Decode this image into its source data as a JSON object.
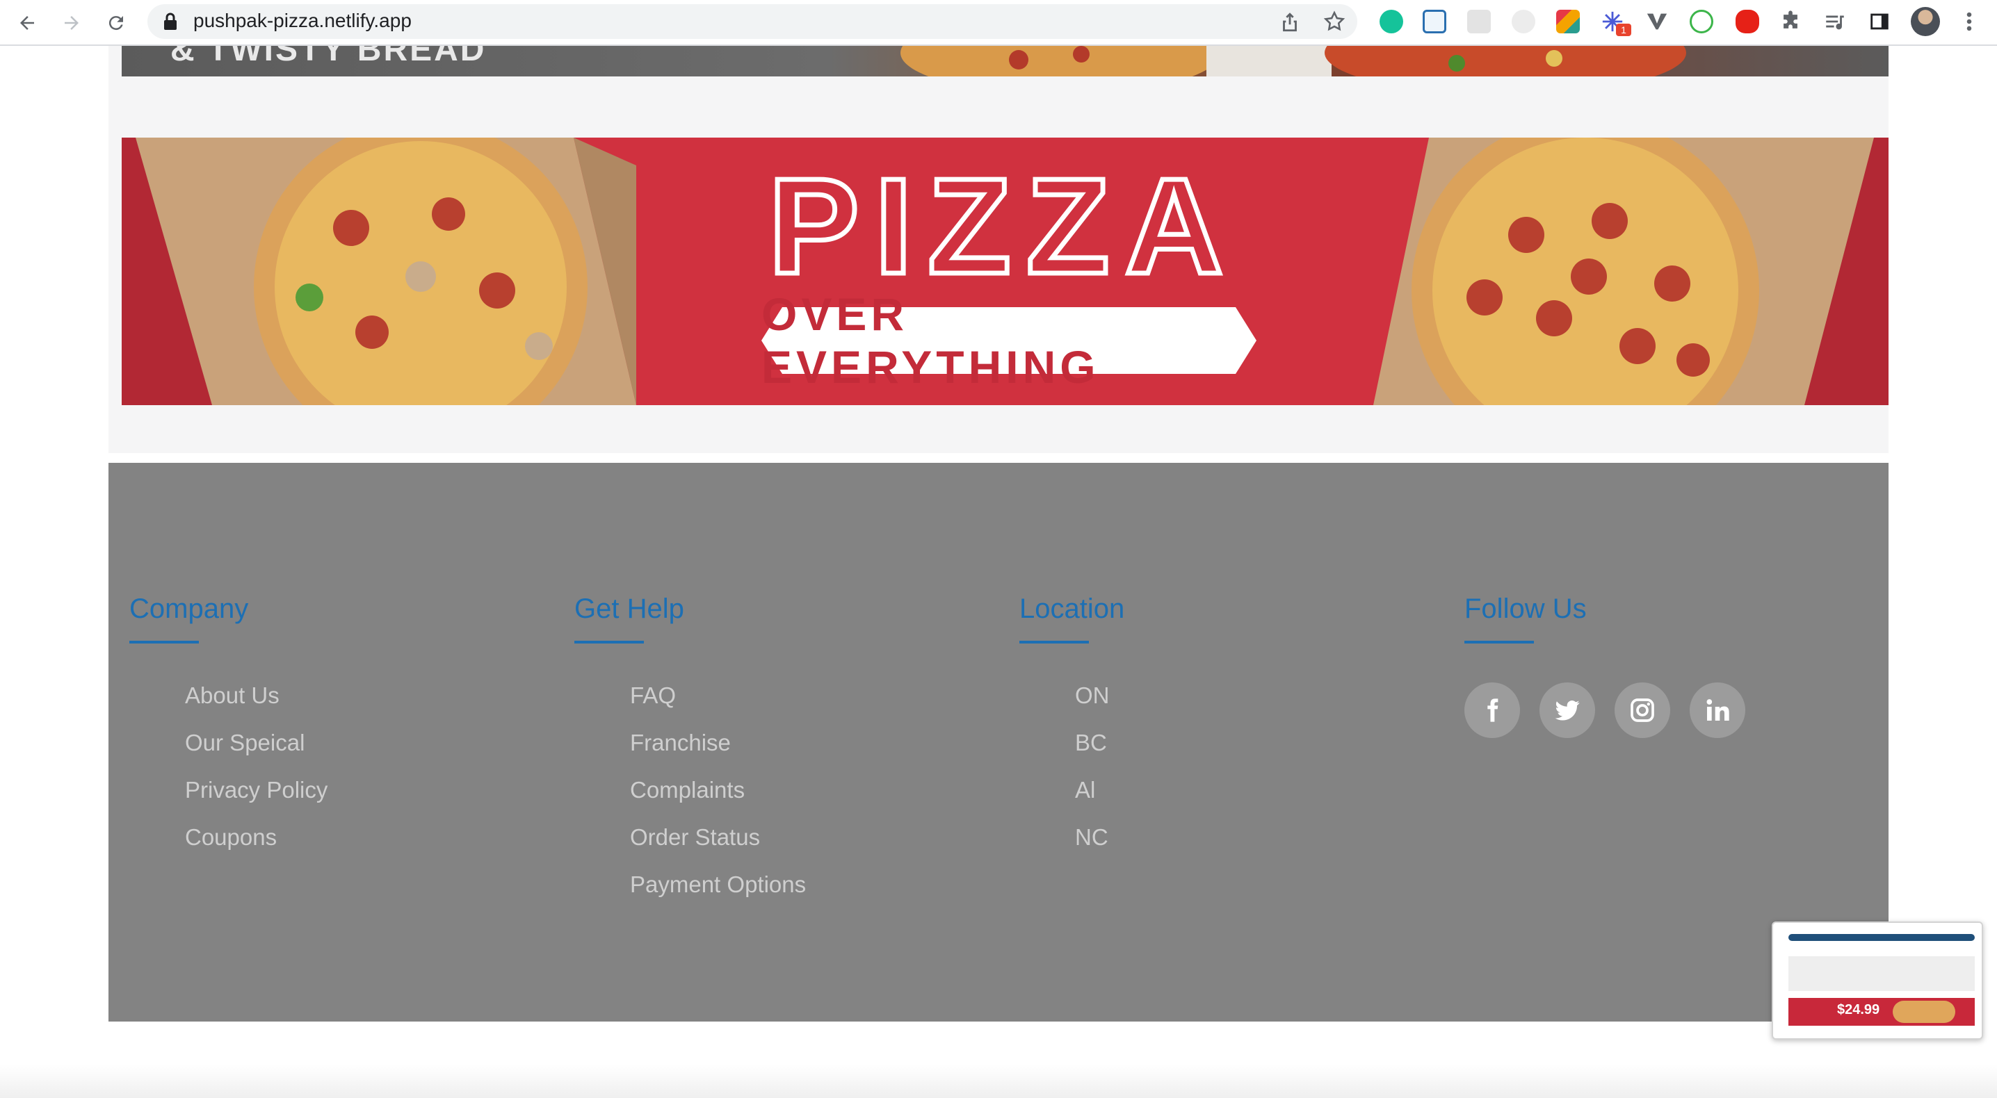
{
  "browser": {
    "url": "pushpak-pizza.netlify.app",
    "extension_badge": "1"
  },
  "top_banner": {
    "text": "& TWISTY BREAD"
  },
  "promo_banner": {
    "headline": "PIZZA",
    "tagline": "OVER EVERYTHING"
  },
  "footer": {
    "columns": [
      {
        "title": "Company",
        "links": [
          "About Us",
          "Our Speical",
          "Privacy Policy",
          "Coupons"
        ]
      },
      {
        "title": "Get Help",
        "links": [
          "FAQ",
          "Franchise",
          "Complaints",
          "Order Status",
          "Payment Options"
        ]
      },
      {
        "title": "Location",
        "links": [
          "ON",
          "BC",
          "Al",
          "NC"
        ]
      },
      {
        "title": "Follow Us",
        "links": []
      }
    ],
    "social": [
      "facebook-icon",
      "twitter-icon",
      "instagram-icon",
      "linkedin-icon"
    ]
  },
  "thumbnail": {
    "price": "$24.99"
  },
  "colors": {
    "accent": "#1c6fb4",
    "footer_bg": "#838383",
    "banner_red": "#d0313f",
    "link": "#cfcfcf"
  }
}
